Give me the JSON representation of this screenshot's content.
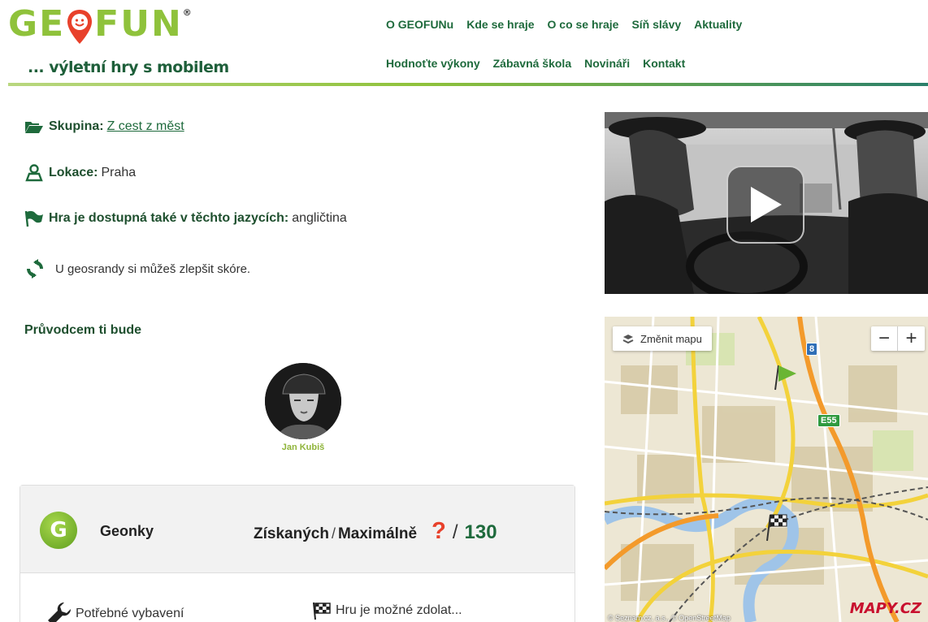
{
  "logo": {
    "word_left": "GE",
    "word_right": "FUN",
    "registered": "®",
    "tagline": "... výletní hry s mobilem"
  },
  "nav": {
    "row1": [
      "O GEOFUNu",
      "Kde se hraje",
      "O co se hraje",
      "Síň slávy",
      "Aktuality"
    ],
    "row2": [
      "Hodnoťte výkony",
      "Zábavná škola",
      "Novináři",
      "Kontakt"
    ]
  },
  "info": {
    "group_label": "Skupina:",
    "group_value": "Z cest z měst",
    "location_label": "Lokace:",
    "location_value": "Praha",
    "languages_label": "Hra je dostupná také v těchto jazycích:",
    "languages_value": "angličtina",
    "improve_text": "U geosrandy si můžeš zlepšit skóre."
  },
  "guide": {
    "title": "Průvodcem ti bude",
    "name": "Jan Kubiš"
  },
  "score": {
    "badge": "G",
    "name": "Geonky",
    "gained_label": "Získaných",
    "slash": "/",
    "max_label": "Maximálně",
    "gained_value": "?",
    "max_slash": "/",
    "max_value": "130"
  },
  "features": {
    "equipment": "Potřebné vybavení",
    "completion": "Hru je možné zdolat..."
  },
  "map": {
    "switch_label": "Změnit mapu",
    "zoom_out": "−",
    "zoom_in": "+",
    "road_8": "8",
    "road_e55": "E55",
    "credits": "© Seznam.cz, a.s., © OpenStreetMap",
    "logo": "MAPY.CZ"
  },
  "colors": {
    "brand_green": "#8fc23b",
    "dark_green": "#1e6a3c",
    "accent_red": "#e8412b"
  }
}
